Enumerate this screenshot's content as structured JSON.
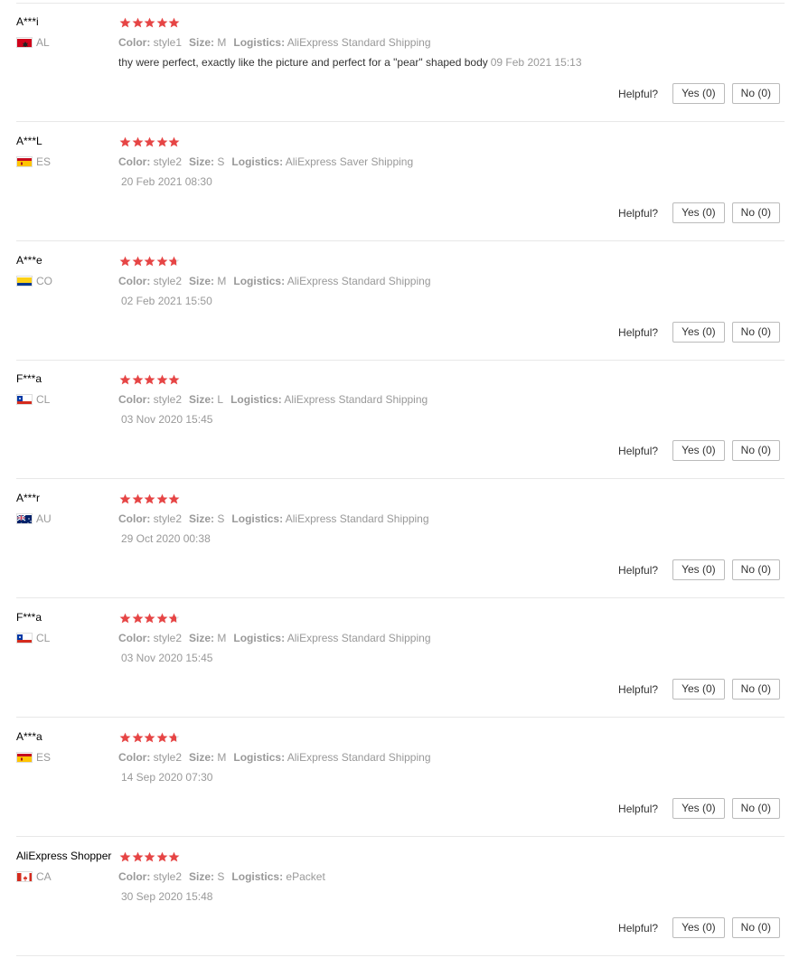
{
  "helpful_label": "Helpful?",
  "colors": {
    "star": "#e64545",
    "muted": "#999999",
    "border": "#e8e8e8"
  },
  "reviews": [
    {
      "user": "A***i",
      "country": "AL",
      "flag": "albania-flag",
      "stars": 5,
      "color_label": "Color:",
      "color": "style1",
      "size_label": "Size:",
      "size": "M",
      "logistics_label": "Logistics:",
      "logistics": "AliExpress Standard Shipping",
      "text": "thy were perfect, exactly like the picture and perfect for a \"pear\" shaped body",
      "date": "09 Feb 2021 15:13",
      "yes": "Yes (0)",
      "no": "No (0)"
    },
    {
      "user": "A***L",
      "country": "ES",
      "flag": "spain-flag",
      "stars": 5,
      "color_label": "Color:",
      "color": "style2",
      "size_label": "Size:",
      "size": "S",
      "logistics_label": "Logistics:",
      "logistics": "AliExpress Saver Shipping",
      "date": "20 Feb 2021 08:30",
      "yes": "Yes (0)",
      "no": "No (0)"
    },
    {
      "user": "A***e",
      "country": "CO",
      "flag": "colombia-flag",
      "stars": 4.5,
      "color_label": "Color:",
      "color": "style2",
      "size_label": "Size:",
      "size": "M",
      "logistics_label": "Logistics:",
      "logistics": "AliExpress Standard Shipping",
      "date": "02 Feb 2021 15:50",
      "yes": "Yes (0)",
      "no": "No (0)"
    },
    {
      "user": "F***a",
      "country": "CL",
      "flag": "chile-flag",
      "stars": 5,
      "color_label": "Color:",
      "color": "style2",
      "size_label": "Size:",
      "size": "L",
      "logistics_label": "Logistics:",
      "logistics": "AliExpress Standard Shipping",
      "date": "03 Nov 2020 15:45",
      "yes": "Yes (0)",
      "no": "No (0)"
    },
    {
      "user": "A***r",
      "country": "AU",
      "flag": "australia-flag",
      "stars": 5,
      "color_label": "Color:",
      "color": "style2",
      "size_label": "Size:",
      "size": "S",
      "logistics_label": "Logistics:",
      "logistics": "AliExpress Standard Shipping",
      "date": "29 Oct 2020 00:38",
      "yes": "Yes (0)",
      "no": "No (0)"
    },
    {
      "user": "F***a",
      "country": "CL",
      "flag": "chile-flag",
      "stars": 4.5,
      "color_label": "Color:",
      "color": "style2",
      "size_label": "Size:",
      "size": "M",
      "logistics_label": "Logistics:",
      "logistics": "AliExpress Standard Shipping",
      "date": "03 Nov 2020 15:45",
      "yes": "Yes (0)",
      "no": "No (0)"
    },
    {
      "user": "A***a",
      "country": "ES",
      "flag": "spain-flag",
      "stars": 4.5,
      "color_label": "Color:",
      "color": "style2",
      "size_label": "Size:",
      "size": "M",
      "logistics_label": "Logistics:",
      "logistics": "AliExpress Standard Shipping",
      "date": "14 Sep 2020 07:30",
      "yes": "Yes (0)",
      "no": "No (0)"
    },
    {
      "user": "AliExpress Shopper",
      "country": "CA",
      "flag": "canada-flag",
      "stars": 5,
      "color_label": "Color:",
      "color": "style2",
      "size_label": "Size:",
      "size": "S",
      "logistics_label": "Logistics:",
      "logistics": "ePacket",
      "date": "30 Sep 2020 15:48",
      "yes": "Yes (0)",
      "no": "No (0)"
    }
  ]
}
